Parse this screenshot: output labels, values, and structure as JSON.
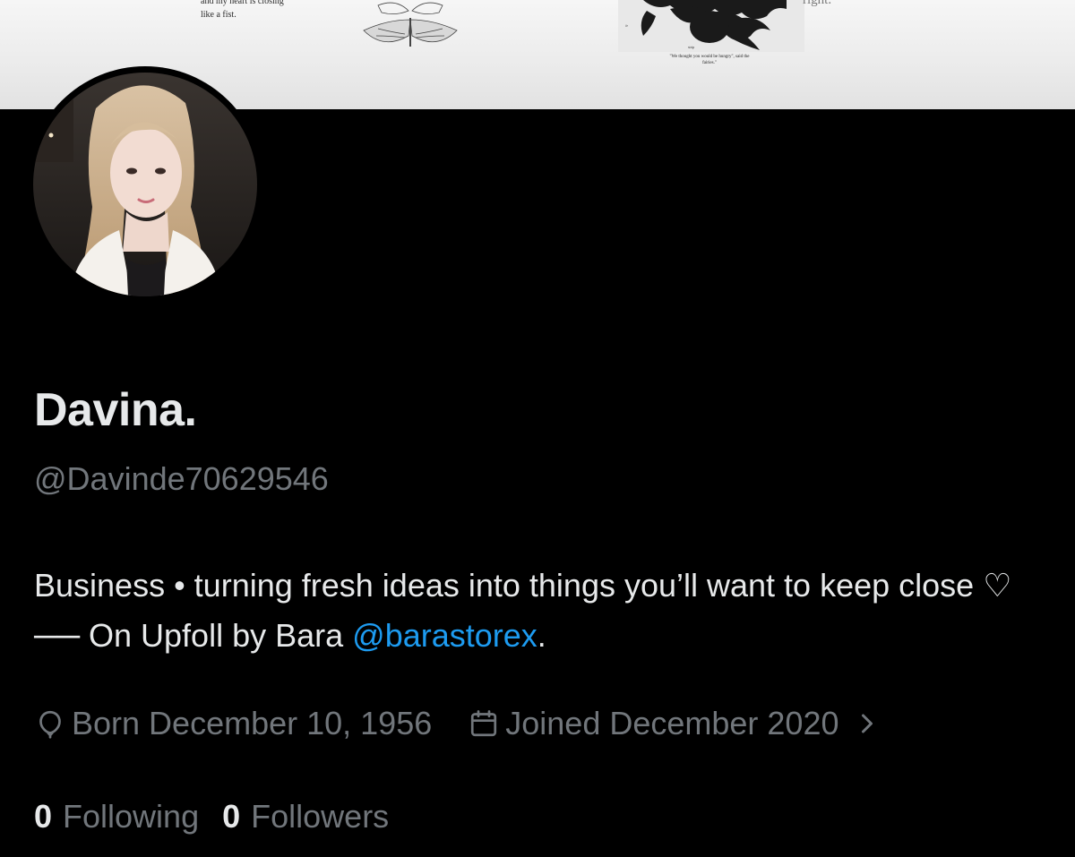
{
  "banner": {
    "left_text_lines": [
      "and my heart is closing",
      "like a fist."
    ],
    "caption_lines": [
      "\"We thought you would be hungry\", said the",
      "fairies.\""
    ],
    "right_text": "right."
  },
  "profile": {
    "display_name": "Davina.",
    "handle": "@Davinde70629546",
    "bio_text": "Business • turning fresh ideas into things you’ll want to keep close ♡ ── On Upfoll by Bara ",
    "bio_mention": "@barastorex",
    "bio_end": ".",
    "birthday": "Born December 10, 1956",
    "joined": "Joined December 2020",
    "following_count": "0",
    "following_label": "Following",
    "followers_count": "0",
    "followers_label": "Followers"
  },
  "icons": {
    "birthday": "balloon-icon",
    "joined": "calendar-icon",
    "expand": "chevron-right-icon"
  },
  "colors": {
    "background": "#000000",
    "primary_text": "#e7e9ea",
    "secondary_text": "#71767b",
    "link": "#1d9bf0"
  }
}
